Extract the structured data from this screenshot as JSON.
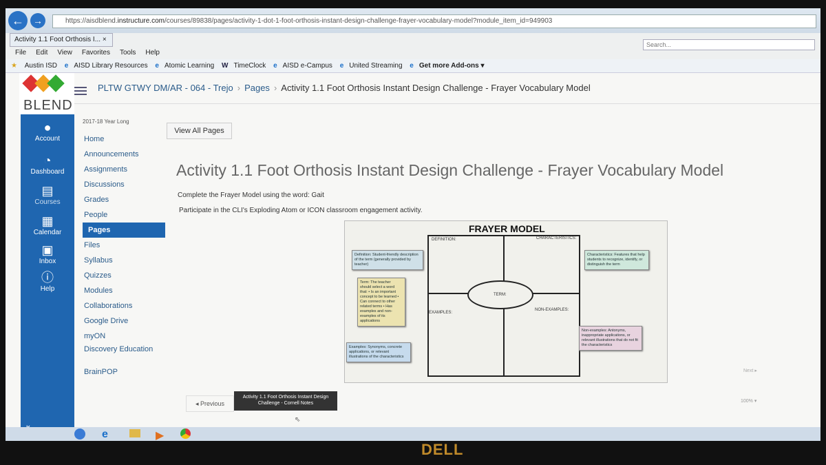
{
  "browser": {
    "url_prefix": "https://aisdblend.",
    "url_domain": "instructure.com",
    "url_path": "/courses/89838/pages/activity-1-dot-1-foot-orthosis-instant-design-challenge-frayer-vocabulary-model?module_item_id=949903",
    "search_placeholder": "Search...",
    "tab_title": "Activity 1.1 Foot Orthosis I...",
    "menu": [
      "File",
      "Edit",
      "View",
      "Favorites",
      "Tools",
      "Help"
    ],
    "favorites": [
      "Austin ISD",
      "AISD Library Resources",
      "Atomic Learning",
      "TimeClock",
      "AISD e-Campus",
      "United Streaming",
      "Get more Add-ons ▾"
    ]
  },
  "logo_text": "BLEND",
  "global_nav": [
    {
      "label": "Account",
      "icon": "account-icon"
    },
    {
      "label": "Dashboard",
      "icon": "dashboard-icon"
    },
    {
      "label": "Courses",
      "icon": "courses-icon"
    },
    {
      "label": "Calendar",
      "icon": "calendar-icon"
    },
    {
      "label": "Inbox",
      "icon": "inbox-icon"
    },
    {
      "label": "Help",
      "icon": "help-icon"
    }
  ],
  "breadcrumb": [
    "PLTW GTWY DM/AR - 064 - Trejo",
    "Pages",
    "Activity 1.1 Foot Orthosis Instant Design Challenge - Frayer Vocabulary Model"
  ],
  "course_nav": {
    "term": "2017-18 Year Long",
    "items": [
      "Home",
      "Announcements",
      "Assignments",
      "Discussions",
      "Grades",
      "People",
      "Pages",
      "Files",
      "Syllabus",
      "Quizzes",
      "Modules",
      "Collaborations",
      "Google Drive",
      "myON",
      "Discovery Education",
      "BrainPOP"
    ],
    "active": "Pages"
  },
  "view_all_pages": "View All Pages",
  "page_title": "Activity 1.1 Foot Orthosis Instant Design Challenge - Frayer Vocabulary Model",
  "paragraph1": "Complete the Frayer Model using the word: Gait",
  "paragraph2": "Participate in the CLI's Exploding Atom or ICON classroom engagement activity.",
  "frayer": {
    "title": "FRAYER MODEL",
    "definition": "DEFINITION:",
    "characteristics": "CHARACTERISTICS:",
    "term": "TERM:",
    "examples": "EXAMPLES:",
    "non_examples": "NON-EXAMPLES:",
    "note_definition": "Definition: Student-friendly description of the term (generally provided by teacher)",
    "note_characteristics": "Characteristics: Features that help students to recognize, identify, or distinguish the term",
    "note_term": "Term: The teacher should select a word that: • Is an important concept to be learned • Can connect to other related terms • Has examples and non-examples of its applications",
    "note_examples": "Examples: Synonyms, concrete applications, or relevant illustrations of the characteristics",
    "note_non_examples": "Non-examples: Antonyms, inappropriate applications, or relevant illustrations that do not fit the characteristics"
  },
  "next": "Next ▸",
  "previous": "◂ Previous",
  "prev_tooltip": "Activity 1.1 Foot Orthosis Instant Design Challenge - Cornell Notes",
  "zoom_level": "100% ▾",
  "monitor_brand": "DELL"
}
